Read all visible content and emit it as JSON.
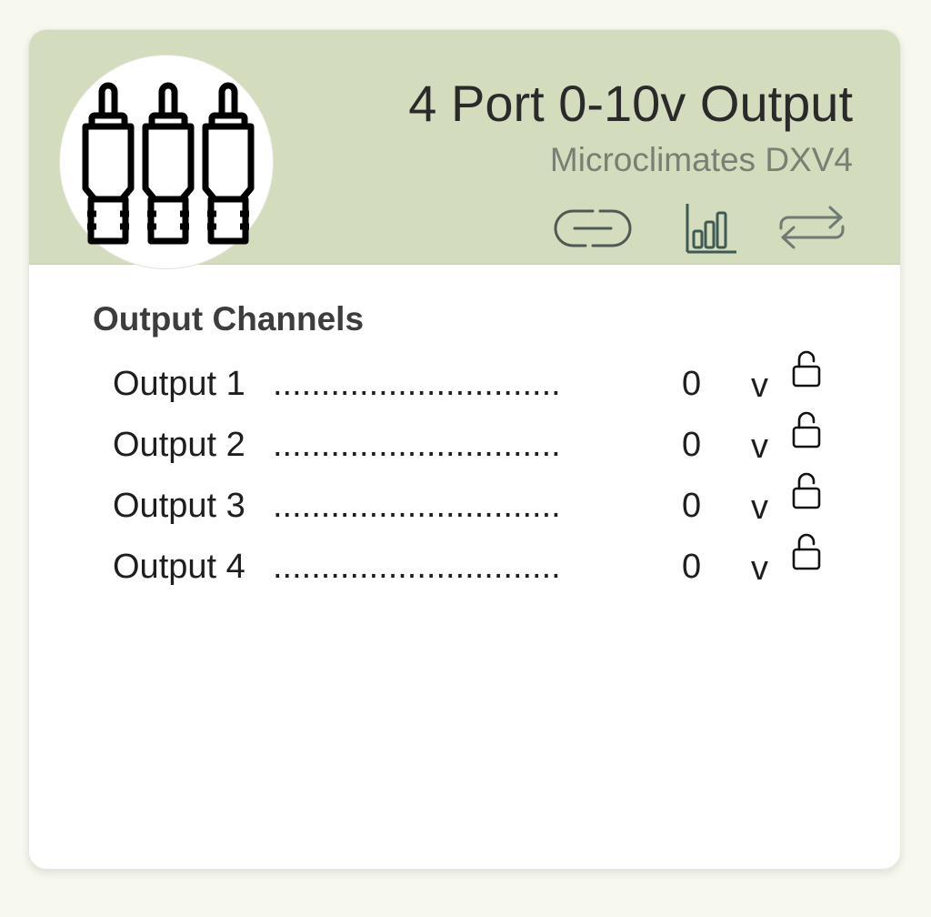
{
  "card": {
    "title": "4 Port 0-10v Output",
    "subtitle": "Microclimates DXV4",
    "header_color": "#d3dcbd",
    "avatar_icon": "rca-connectors-icon",
    "actions": [
      {
        "icon": "link-icon"
      },
      {
        "icon": "bar-chart-icon"
      },
      {
        "icon": "swap-icon"
      }
    ]
  },
  "output_channels": {
    "heading": "Output Channels",
    "rows": [
      {
        "label": "Output 1",
        "leader": "..............................",
        "value": "0",
        "unit": "v",
        "lock_icon": "unlock-icon"
      },
      {
        "label": "Output 2",
        "leader": "..............................",
        "value": "0",
        "unit": "v",
        "lock_icon": "unlock-icon"
      },
      {
        "label": "Output 3",
        "leader": "..............................",
        "value": "0",
        "unit": "v",
        "lock_icon": "unlock-icon"
      },
      {
        "label": "Output 4",
        "leader": "..............................",
        "value": "0",
        "unit": "v",
        "lock_icon": "unlock-icon"
      }
    ]
  }
}
